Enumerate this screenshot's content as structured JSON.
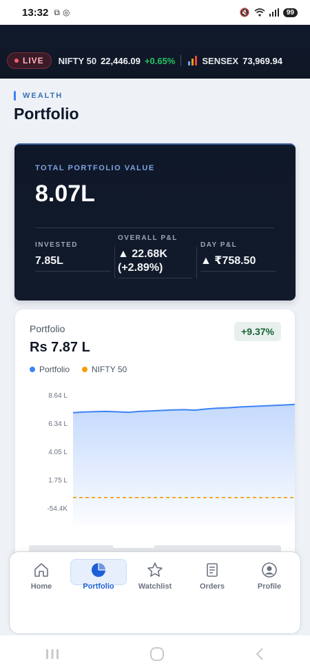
{
  "status_bar": {
    "time": "13:32",
    "battery": "99"
  },
  "ticker": {
    "live_label": "LIVE",
    "items": [
      {
        "name": "NIFTY 50",
        "value": "22,446.09",
        "change": "+0.65%"
      },
      {
        "name": "SENSEX",
        "value": "73,969.94",
        "change": ""
      }
    ]
  },
  "header": {
    "section": "WEALTH",
    "title": "Portfolio"
  },
  "summary": {
    "label": "TOTAL PORTFOLIO VALUE",
    "value": "8.07L",
    "stats": [
      {
        "label": "INVESTED",
        "value": "7.85L"
      },
      {
        "label": "OVERALL P&L",
        "value": "▲ 22.68K\n(+2.89%)"
      },
      {
        "label": "DAY P&L",
        "value": "▲ ₹758.50"
      }
    ]
  },
  "chart_card": {
    "title": "Portfolio",
    "amount": "Rs 7.87 L",
    "change_badge": "+9.37%",
    "accent_color": "#3b82f6",
    "benchmark_color": "#f59e0b"
  },
  "chart_data": {
    "type": "area",
    "yticks": [
      "8.64 L",
      "6.34 L",
      "4.05 L",
      "1.75 L",
      "-54.4K"
    ],
    "ylim": [
      -0.544,
      8.64
    ],
    "grid": false,
    "legend": "top-left",
    "series": [
      {
        "name": "Portfolio",
        "values": [
          7.2,
          7.25,
          7.28,
          7.3,
          7.27,
          7.23,
          7.3,
          7.34,
          7.38,
          7.42,
          7.44,
          7.4,
          7.5,
          7.56,
          7.6,
          7.66,
          7.7,
          7.74,
          7.78,
          7.82,
          7.87
        ]
      },
      {
        "name": "NIFTY 50",
        "values": [
          0.3,
          0.3,
          0.3,
          0.3,
          0.3,
          0.3,
          0.3,
          0.3,
          0.3,
          0.3,
          0.3,
          0.3,
          0.3,
          0.3,
          0.3,
          0.3,
          0.3,
          0.3,
          0.3,
          0.3,
          0.3
        ]
      }
    ]
  },
  "bottom_nav": {
    "items": [
      {
        "label": "Home",
        "icon": "home-icon"
      },
      {
        "label": "Portfolio",
        "icon": "pie-chart-icon"
      },
      {
        "label": "Watchlist",
        "icon": "star-icon"
      },
      {
        "label": "Orders",
        "icon": "receipt-icon"
      },
      {
        "label": "Profile",
        "icon": "user-icon"
      }
    ],
    "active_index": 1
  }
}
